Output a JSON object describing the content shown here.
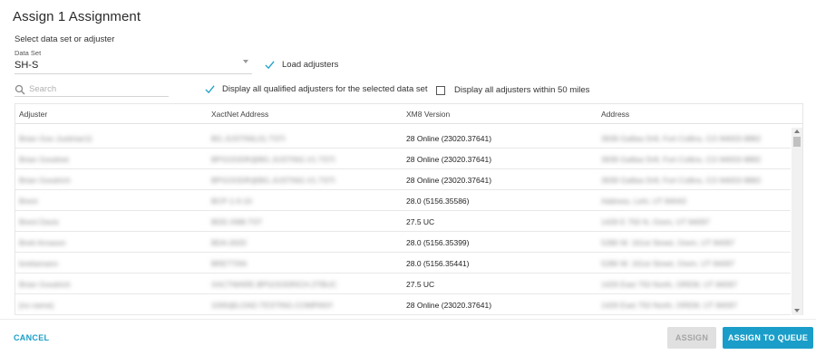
{
  "dialog": {
    "title": "Assign 1 Assignment",
    "section_label": "Select data set or adjuster"
  },
  "data_set": {
    "label": "Data Set",
    "value": "SH-S"
  },
  "options": {
    "load_adjusters": {
      "label": "Load adjusters",
      "checked": true
    },
    "display_qualified": {
      "label": "Display all qualified adjusters for the selected data set",
      "checked": true
    },
    "display_within_50": {
      "label": "Display all adjusters within 50 miles",
      "checked": false
    }
  },
  "search": {
    "placeholder": "Search",
    "value": ""
  },
  "table": {
    "columns": [
      "Adjuster",
      "XactNet Address",
      "XM8 Version",
      "Address"
    ],
    "rows": [
      {
        "adjuster": "Brian Goo Justiniar11",
        "xactnet": "BG.JUSTINIL01.TSTI",
        "version": "28 Online (23020.37641)",
        "address": "3939 Gallias Dr8, Fort Collins, CO 84003-9882"
      },
      {
        "adjuster": "Brian Goodnet",
        "xactnet": "BPGOODR@BG.JUSTING.V1.TSTI",
        "version": "28 Online (23020.37641)",
        "address": "3939 Gallias Dr8, Fort Collins, CO 84003-9882"
      },
      {
        "adjuster": "Brian Goodrich",
        "xactnet": "BPGOODR@BG.JUSTING.V1.TSTI",
        "version": "28 Online (23020.37641)",
        "address": "3939 Gallias Dr8, Fort Collins, CO 84003-9882"
      },
      {
        "adjuster": "Brent",
        "xactnet": "BCP-1-0-10",
        "version": "28.0 (5156.35586)",
        "address": "Address, Lehi, UT 84043"
      },
      {
        "adjuster": "Brent Davis",
        "xactnet": "BDD.XM8.TST",
        "version": "27.5 UC",
        "address": "1426 E 750 N, Orem, UT 84097"
      },
      {
        "adjuster": "Brett Arnason",
        "xactnet": "BDA.0020",
        "version": "28.0 (5156.35399)",
        "address": "5280 W. 161st Street, Orem, UT 84097"
      },
      {
        "adjuster": "brettamann",
        "xactnet": "BRETTAN",
        "version": "28.0 (5156.35441)",
        "address": "5280 W. 161st Street, Orem, UT 84097"
      },
      {
        "adjuster": "Brian Goodrich",
        "xactnet": "XACTWARE.BPGOODRICH.2TBUC",
        "version": "27.5 UC",
        "address": "1426 East 750 North, OREM, UT 84097"
      },
      {
        "adjuster": "[no name]",
        "xactnet": "1000@LOAD.TESTING.COMPANY",
        "version": "28 Online (23020.37641)",
        "address": "1426 East 750 North, OREM, UT 84097"
      },
      {
        "adjuster": "",
        "xactnet": "",
        "version": "",
        "address": ""
      }
    ]
  },
  "footer": {
    "cancel_label": "CANCEL",
    "assign_label": "ASSIGN",
    "assign_queue_label": "ASSIGN TO QUEUE"
  },
  "colors": {
    "accent": "#1a9ec9",
    "disabled_bg": "#e0e0e0",
    "checkmark": "#1a9ec9"
  },
  "icons": {
    "search": "search-icon",
    "check": "checkmark-icon",
    "dropdown": "chevron-down-icon"
  }
}
